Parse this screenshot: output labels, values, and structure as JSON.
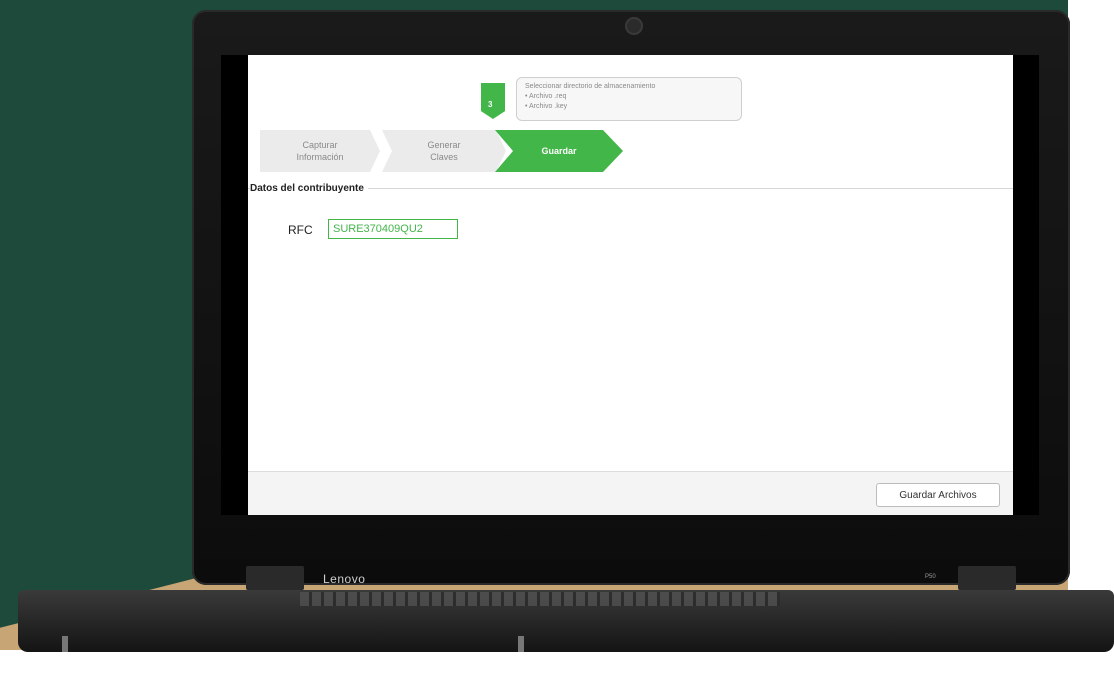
{
  "brand": {
    "name": "Lenovo",
    "model": "P50"
  },
  "colors": {
    "accent": "#43b649",
    "background_green": "#1e4a3c"
  },
  "wizard": {
    "step_number": "3",
    "tooltip": {
      "title": "Seleccionar directorio de almacenamiento",
      "items": [
        "Archivo .req",
        "Archivo .key"
      ]
    },
    "steps": [
      {
        "label_line1": "Capturar",
        "label_line2": "Información",
        "state": "completed"
      },
      {
        "label_line1": "Generar",
        "label_line2": "Claves",
        "state": "completed"
      },
      {
        "label_line1": "Guardar",
        "label_line2": "",
        "state": "active"
      }
    ]
  },
  "form": {
    "section_title": "Datos del contribuyente",
    "rfc_label": "RFC",
    "rfc_value": "SURE370409QU2"
  },
  "footer": {
    "save_label": "Guardar Archivos"
  }
}
